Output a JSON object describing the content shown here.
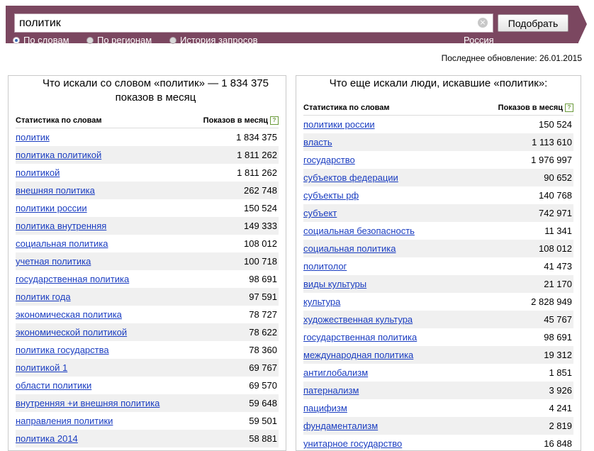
{
  "search": {
    "query": "политик",
    "submit_label": "Подобрать",
    "clear_icon": "×",
    "modes": [
      {
        "label": "По словам",
        "checked": true
      },
      {
        "label": "По регионам",
        "checked": false
      },
      {
        "label": "История запросов",
        "checked": false
      }
    ],
    "region": "Россия"
  },
  "last_update": "Последнее обновление: 26.01.2015",
  "left_panel": {
    "title_line1": "Что искали со словом «политик» — 1 834 375",
    "title_line2": "показов в месяц",
    "header_word": "Статистика по словам",
    "header_count": "Показов в месяц",
    "help_icon": "?",
    "rows": [
      {
        "word": "политик",
        "count": "1 834 375"
      },
      {
        "word": "политика политикой",
        "count": "1 811 262"
      },
      {
        "word": "политикой",
        "count": "1 811 262"
      },
      {
        "word": "внешняя политика",
        "count": "262 748"
      },
      {
        "word": "политики россии",
        "count": "150 524"
      },
      {
        "word": "политика внутренняя",
        "count": "149 333"
      },
      {
        "word": "социальная политика",
        "count": "108 012"
      },
      {
        "word": "учетная политика",
        "count": "100 718"
      },
      {
        "word": "государственная политика",
        "count": "98 691"
      },
      {
        "word": "политик года",
        "count": "97 591"
      },
      {
        "word": "экономическая политика",
        "count": "78 727"
      },
      {
        "word": "экономической политикой",
        "count": "78 622"
      },
      {
        "word": "политика государства",
        "count": "78 360"
      },
      {
        "word": "политикой 1",
        "count": "69 767"
      },
      {
        "word": "области политики",
        "count": "69 570"
      },
      {
        "word": "внутренняя +и внешняя политика",
        "count": "59 648"
      },
      {
        "word": "направления политики",
        "count": "59 501"
      },
      {
        "word": "политика 2014",
        "count": "58 881"
      }
    ]
  },
  "right_panel": {
    "title": "Что еще искали люди, искавшие «политик»:",
    "header_word": "Статистика по словам",
    "header_count": "Показов в месяц",
    "help_icon": "?",
    "rows": [
      {
        "word": "политики россии",
        "count": "150 524"
      },
      {
        "word": "власть",
        "count": "1 113 610"
      },
      {
        "word": "государство",
        "count": "1 976 997"
      },
      {
        "word": "субъектов федерации",
        "count": "90 652"
      },
      {
        "word": "субъекты рф",
        "count": "140 768"
      },
      {
        "word": "субъект",
        "count": "742 971"
      },
      {
        "word": "социальная безопасность",
        "count": "11 341"
      },
      {
        "word": "социальная политика",
        "count": "108 012"
      },
      {
        "word": "политолог",
        "count": "41 473"
      },
      {
        "word": "виды культуры",
        "count": "21 170"
      },
      {
        "word": "культура",
        "count": "2 828 949"
      },
      {
        "word": "художественная культура",
        "count": "45 767"
      },
      {
        "word": "государственная политика",
        "count": "98 691"
      },
      {
        "word": "международная политика",
        "count": "19 312"
      },
      {
        "word": "антиглобализм",
        "count": "1 851"
      },
      {
        "word": "патернализм",
        "count": "3 926"
      },
      {
        "word": "пацифизм",
        "count": "4 241"
      },
      {
        "word": "фундаментализм",
        "count": "2 819"
      },
      {
        "word": "унитарное государство",
        "count": "16 848"
      }
    ]
  }
}
